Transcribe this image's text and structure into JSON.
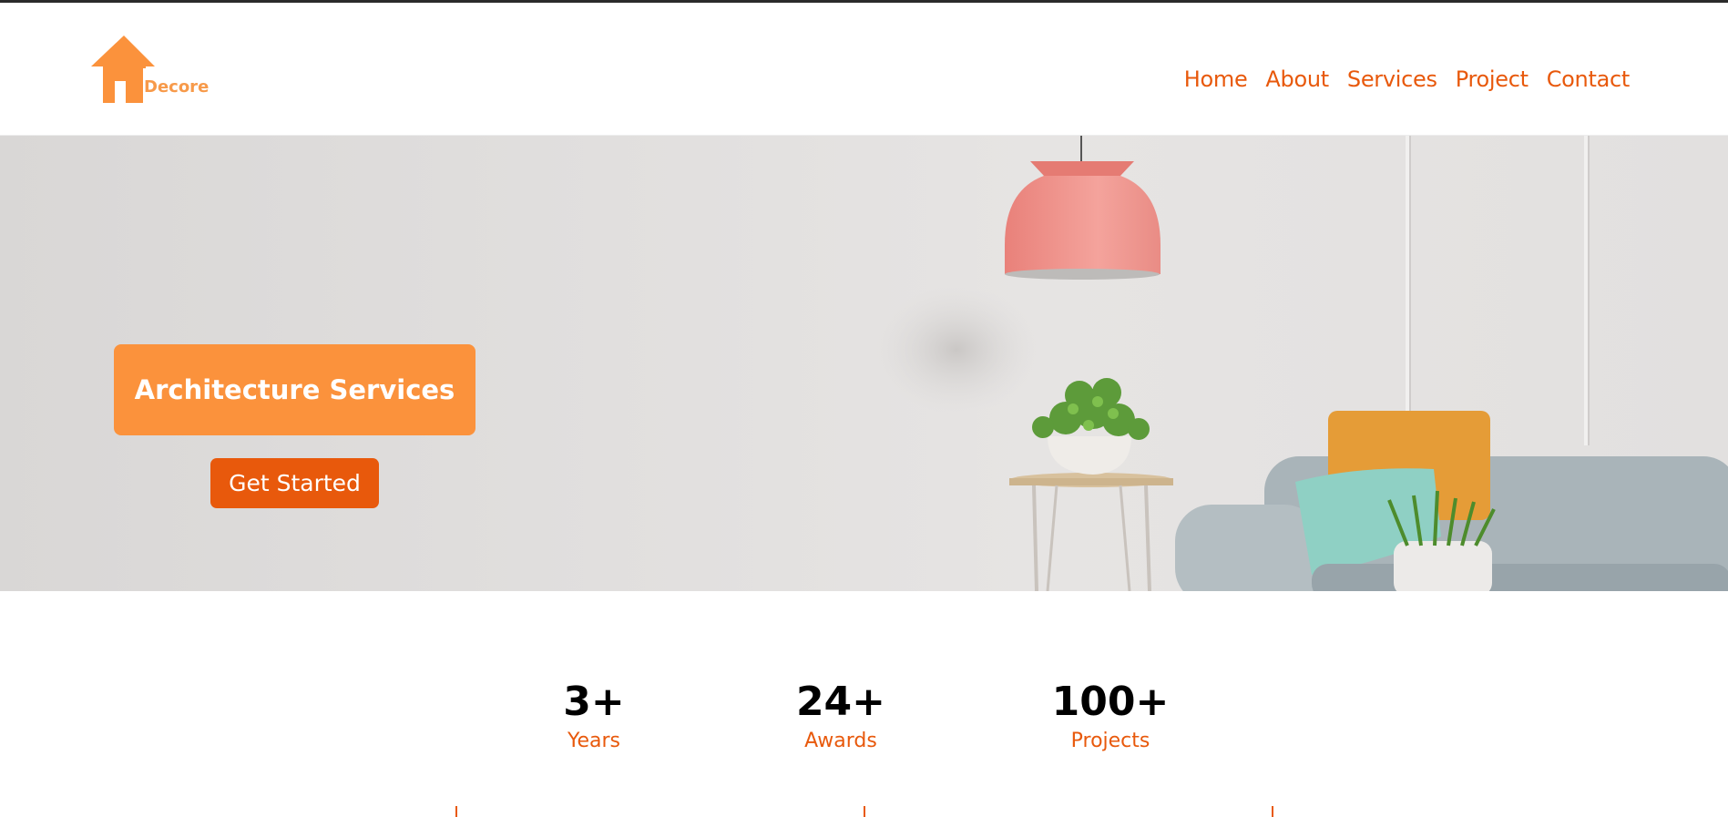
{
  "brand": {
    "name": "Decore",
    "color": "#f79a4a",
    "icon": "house-icon"
  },
  "nav": {
    "items": [
      "Home",
      "About",
      "Services",
      "Project",
      "Contact"
    ]
  },
  "hero": {
    "title": "Architecture Services",
    "cta_label": "Get Started"
  },
  "stats": [
    {
      "value": "3+",
      "label": "Years"
    },
    {
      "value": "24+",
      "label": "Awards"
    },
    {
      "value": "100+",
      "label": "Projects"
    }
  ],
  "colors": {
    "accent": "#e8590c",
    "card": "#fb923c",
    "text": "#000000"
  }
}
